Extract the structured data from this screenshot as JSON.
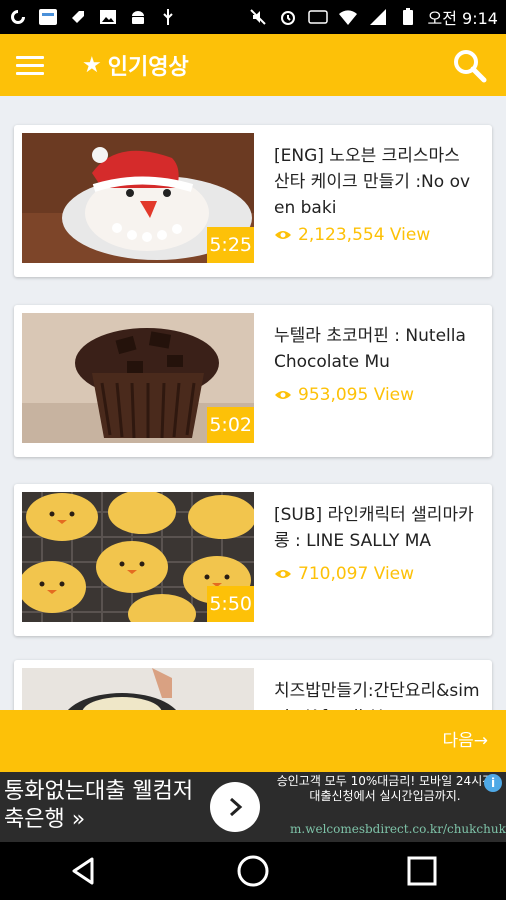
{
  "status_bar": {
    "time": "오전 9:14",
    "icons": [
      "app-g-icon",
      "newsapp-icon",
      "tag-icon",
      "image-icon",
      "android-icon",
      "usb-icon",
      "mute-icon",
      "alarm-icon",
      "hd-icon",
      "wifi-icon",
      "signal-icon",
      "battery-icon"
    ]
  },
  "app_bar": {
    "title": "인기영상",
    "star": "★"
  },
  "colors": {
    "accent": "#fdc108",
    "background": "#eceff3"
  },
  "videos": [
    {
      "title": "[ENG] 노오븐 크리스마스 산타 케이크 만들기 :No oven baki",
      "views": "2,123,554 View",
      "duration": "5:25",
      "thumbnail": "santa-cake"
    },
    {
      "title": "누텔라 초코머핀 : Nutella Chocolate Mu",
      "views": "953,095 View",
      "duration": "5:02",
      "thumbnail": "chocolate-muffin"
    },
    {
      "title": "[SUB] 라인캐릭터 샐리마카롱 : LINE SALLY MA",
      "views": "710,097 View",
      "duration": "5:50",
      "thumbnail": "sally-macaron"
    },
    {
      "title": "치즈밥만들기:간단요리&simple K-food) How to",
      "views": "",
      "duration": "",
      "thumbnail": "cheese-rice"
    }
  ],
  "next_button": "다음→",
  "ad": {
    "headline": "통화없는대출 웰컴저축은행 »",
    "description": "승인고객 모두 10%대금리! 모바일 24시간 대출신청에서 실시간입금까지.",
    "url": "m.welcomesbdirect.co.kr/chukchuk",
    "info": "i"
  }
}
